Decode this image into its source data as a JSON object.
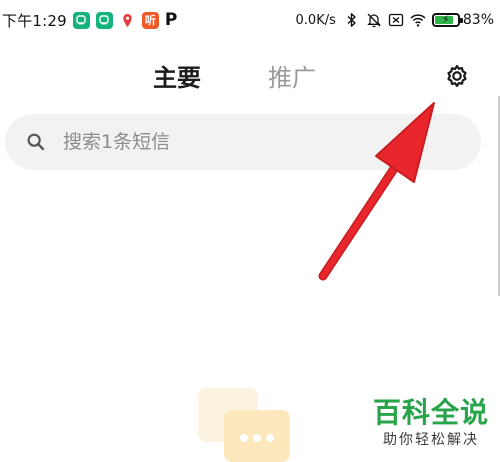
{
  "status_bar": {
    "time": "下午1:29",
    "notification_icons": [
      "app-green-icon",
      "app-green-icon",
      "location-pin-icon",
      "ting-app-icon",
      "p-app-icon"
    ],
    "red_icon_text": "听",
    "p_icon_text": "P",
    "net_speed": "0.0K/s",
    "battery_percent": "83%",
    "battery_level": 0.83,
    "battery_color": "#2fb64a"
  },
  "tabs": {
    "main": "主要",
    "promotions": "推广"
  },
  "search": {
    "placeholder": "搜索1条短信"
  },
  "colors": {
    "arrow": "#e8262b",
    "watermark": "#27a34a",
    "search_bg": "#f2f2f2"
  },
  "watermark": {
    "title": "百科全说",
    "subtitle": "助你轻松解决"
  }
}
